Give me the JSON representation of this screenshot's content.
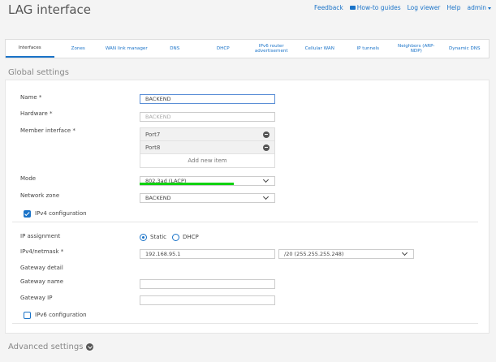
{
  "header": {
    "title": "LAG interface"
  },
  "topnav": {
    "feedback": "Feedback",
    "howto": "How-to guides",
    "logviewer": "Log viewer",
    "help": "Help",
    "admin": "admin"
  },
  "tabs": [
    "Interfaces",
    "Zones",
    "WAN link manager",
    "DNS",
    "DHCP",
    "IPv6 router advertisement",
    "Cellular WAN",
    "IP tunnels",
    "Neighbors (ARP-NDP)",
    "Dynamic DNS"
  ],
  "global": {
    "section_title": "Global settings",
    "name_label": "Name *",
    "name_value": "BACKEND",
    "hardware_label": "Hardware *",
    "hardware_value": "BACKEND",
    "member_label": "Member interface *",
    "members": [
      "Port7",
      "Port8"
    ],
    "add_item": "Add new item",
    "mode_label": "Mode",
    "mode_value": "802.3ad (LACP)",
    "zone_label": "Network zone",
    "zone_value": "BACKEND",
    "ipv4_label": "IPv4 configuration",
    "ipassign_label": "IP assignment",
    "static_label": "Static",
    "dhcp_label": "DHCP",
    "ipv4mask_label": "IPv4/netmask *",
    "ip_value": "192.168.95.1",
    "netmask_value": "/20 (255.255.255.248)",
    "gw_detail_label": "Gateway detail",
    "gw_name_label": "Gateway name",
    "gw_ip_label": "Gateway IP",
    "ipv6_label": "IPv6 configuration"
  },
  "advanced": {
    "label": "Advanced settings"
  },
  "colors": {
    "accent": "#1a73c8",
    "highlight": "#11d211"
  }
}
